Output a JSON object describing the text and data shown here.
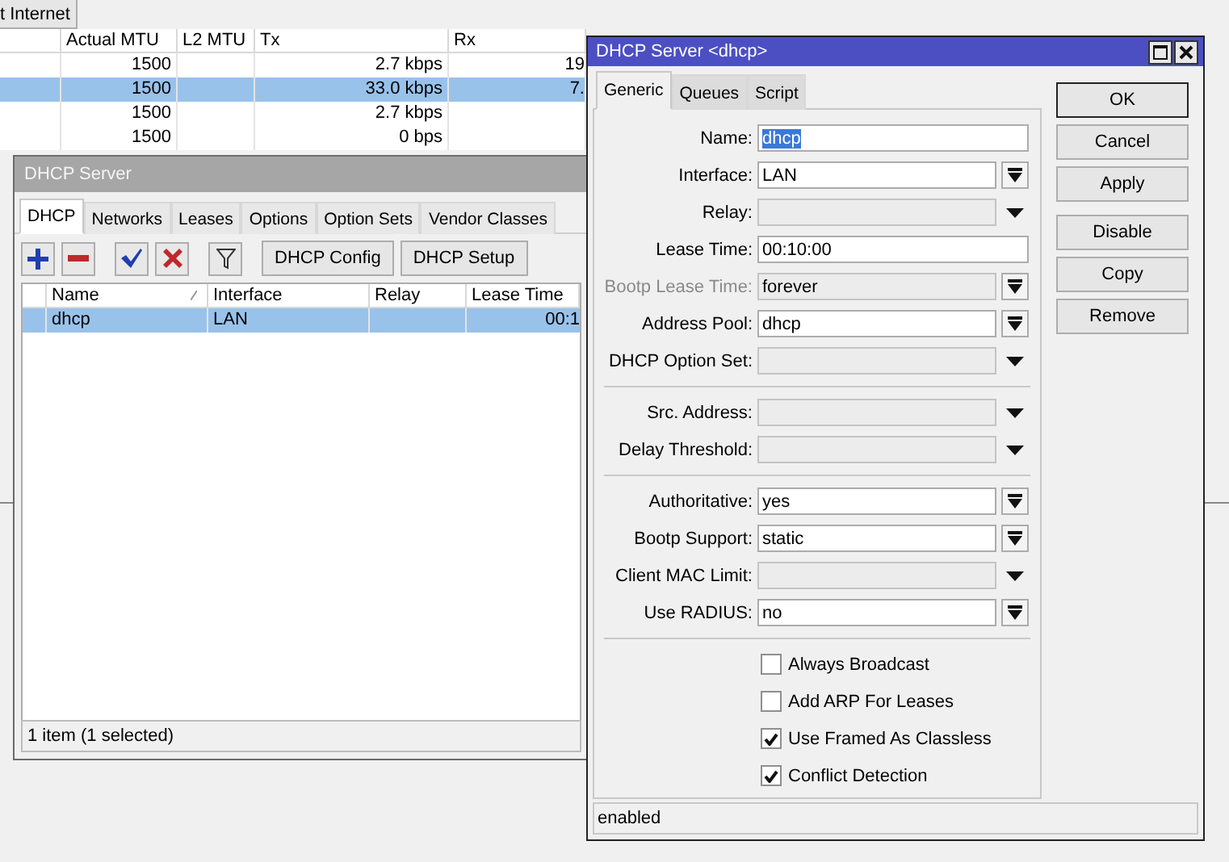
{
  "interfaces_window": {
    "toolbar_button": "t Internet",
    "columns": [
      "Actual MTU",
      "L2 MTU",
      "Tx",
      "Rx"
    ],
    "rows": [
      {
        "actual_mtu": "1500",
        "tx": "2.7 kbps",
        "rx": "19",
        "selected": false
      },
      {
        "actual_mtu": "1500",
        "tx": "33.0 kbps",
        "rx": "7.",
        "selected": true
      },
      {
        "actual_mtu": "1500",
        "tx": "2.7 kbps",
        "selected": false
      },
      {
        "actual_mtu": "1500",
        "tx": "0 bps",
        "selected": false
      }
    ]
  },
  "dhcp_window": {
    "title": "DHCP Server",
    "tabs": [
      {
        "label": "DHCP",
        "selected": true
      },
      {
        "label": "Networks",
        "selected": false
      },
      {
        "label": "Leases",
        "selected": false
      },
      {
        "label": "Options",
        "selected": false
      },
      {
        "label": "Option Sets",
        "selected": false
      },
      {
        "label": "Vendor Classes",
        "selected": false
      }
    ],
    "toolbar_buttons": [
      "DHCP Config",
      "DHCP Setup"
    ],
    "columns": [
      "Name",
      "Interface",
      "Relay",
      "Lease Time"
    ],
    "rows": [
      {
        "name": "dhcp",
        "interface": "LAN",
        "lease_time": "00:1",
        "selected": true
      }
    ],
    "status": "1 item (1 selected)"
  },
  "dialog": {
    "title": "DHCP Server <dhcp>",
    "tabs": [
      {
        "label": "Generic",
        "selected": true
      },
      {
        "label": "Queues",
        "selected": false
      },
      {
        "label": "Script",
        "selected": false
      }
    ],
    "field_groups": [
      {
        "fields": [
          {
            "label": "Name:",
            "kind": "text",
            "value": "dhcp",
            "disabled": false,
            "value_selected": true
          },
          {
            "label": "Interface:",
            "kind": "select",
            "value": "LAN",
            "disabled": false,
            "value_selected": false
          },
          {
            "label": "Relay:",
            "kind": "combo",
            "disabled": false
          },
          {
            "label": "Lease Time:",
            "kind": "text",
            "value": "00:10:00",
            "disabled": false,
            "value_selected": false
          },
          {
            "label": "Bootp Lease Time:",
            "kind": "select",
            "value": "forever",
            "disabled": true,
            "value_selected": false
          },
          {
            "label": "Address Pool:",
            "kind": "select",
            "value": "dhcp",
            "disabled": false,
            "value_selected": false
          },
          {
            "label": "DHCP Option Set:",
            "kind": "combo",
            "disabled": false
          }
        ]
      },
      {
        "fields": [
          {
            "label": "Src. Address:",
            "kind": "combo",
            "disabled": false
          },
          {
            "label": "Delay Threshold:",
            "kind": "combo",
            "disabled": false
          }
        ]
      },
      {
        "fields": [
          {
            "label": "Authoritative:",
            "kind": "select",
            "value": "yes",
            "disabled": false,
            "value_selected": false
          },
          {
            "label": "Bootp Support:",
            "kind": "select",
            "value": "static",
            "disabled": false,
            "value_selected": false
          },
          {
            "label": "Client MAC Limit:",
            "kind": "combo",
            "disabled": false
          },
          {
            "label": "Use RADIUS:",
            "kind": "select",
            "value": "no",
            "disabled": false,
            "value_selected": false
          }
        ]
      }
    ],
    "checkboxes": [
      {
        "label": "Always Broadcast",
        "checked": false
      },
      {
        "label": "Add ARP For Leases",
        "checked": false
      },
      {
        "label": "Use Framed As Classless",
        "checked": true
      },
      {
        "label": "Conflict Detection",
        "checked": true
      }
    ],
    "buttons": [
      {
        "label": "OK",
        "default": true
      },
      {
        "label": "Cancel",
        "default": false
      },
      {
        "label": "Apply",
        "default": false
      },
      {
        "label": "Disable",
        "default": false
      },
      {
        "label": "Copy",
        "default": false
      },
      {
        "label": "Remove",
        "default": false
      }
    ],
    "status": "enabled"
  }
}
